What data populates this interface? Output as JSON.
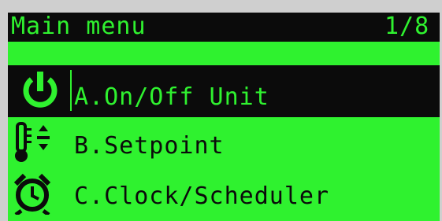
{
  "screen": {
    "title": "Main menu",
    "page_indicator": "1/8"
  },
  "menu": {
    "items": [
      {
        "label": "A.On/Off Unit",
        "icon": "power-icon",
        "selected": true
      },
      {
        "label": "B.Setpoint",
        "icon": "thermometer-setpoint-icon",
        "selected": false
      },
      {
        "label": "C.Clock/Scheduler",
        "icon": "alarm-clock-icon",
        "selected": false
      }
    ]
  },
  "colors": {
    "lcd_background": "#2ff22f",
    "lcd_foreground": "#0b0b0b"
  }
}
